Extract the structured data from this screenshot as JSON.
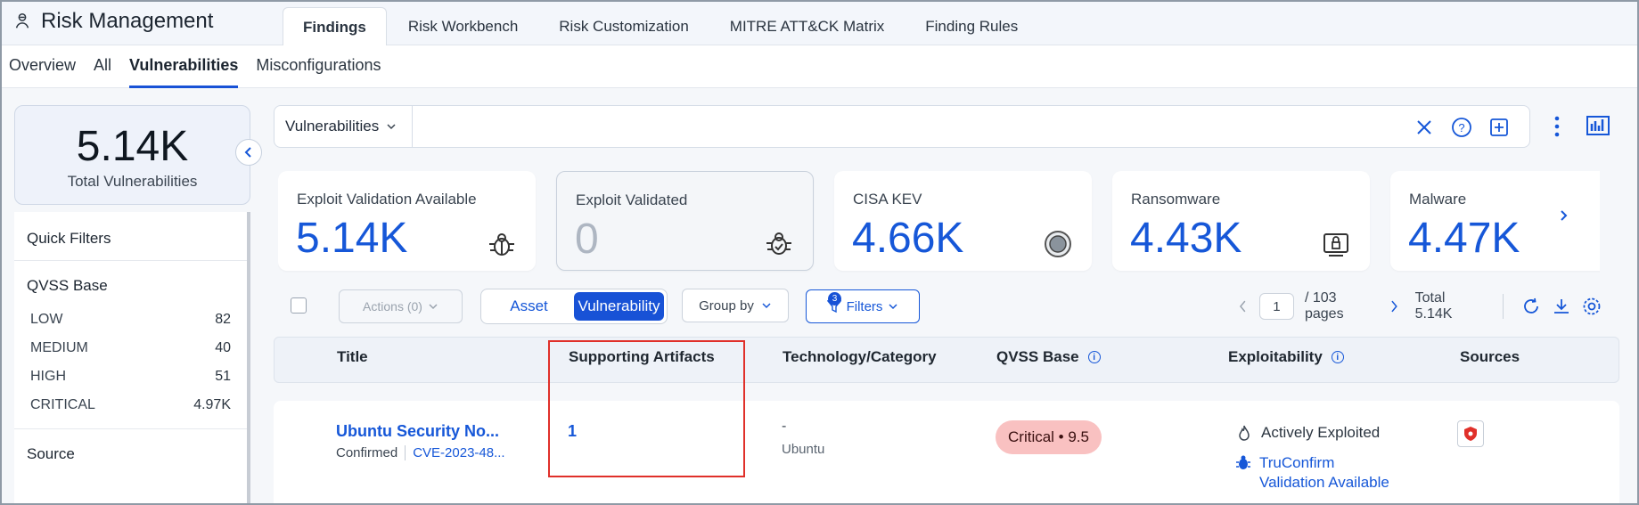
{
  "app": {
    "title": "Risk Management"
  },
  "tabs": [
    "Findings",
    "Risk Workbench",
    "Risk Customization",
    "MITRE ATT&CK Matrix",
    "Finding Rules"
  ],
  "subtabs": [
    "Overview",
    "All",
    "Vulnerabilities",
    "Misconfigurations"
  ],
  "total": {
    "value": "5.14K",
    "label": "Total Vulnerabilities"
  },
  "quick_filters": {
    "title": "Quick Filters",
    "qvss_title": "QVSS Base",
    "rows": [
      {
        "label": "LOW",
        "value": "82"
      },
      {
        "label": "MEDIUM",
        "value": "40"
      },
      {
        "label": "HIGH",
        "value": "51"
      },
      {
        "label": "CRITICAL",
        "value": "4.97K"
      }
    ],
    "source_title": "Source"
  },
  "search": {
    "select_value": "Vulnerabilities",
    "placeholder": ""
  },
  "stats": [
    {
      "label": "Exploit Validation Available",
      "value": "5.14K",
      "icon": "bug-icon"
    },
    {
      "label": "Exploit Validated",
      "value": "0",
      "icon": "bug-icon"
    },
    {
      "label": "CISA KEV",
      "value": "4.66K",
      "icon": "seal-icon"
    },
    {
      "label": "Ransomware",
      "value": "4.43K",
      "icon": "ransomware-icon"
    },
    {
      "label": "Malware",
      "value": "4.47K",
      "icon": "malware-icon"
    }
  ],
  "toolbar": {
    "actions": "Actions (0)",
    "seg": [
      "Asset",
      "Vulnerability"
    ],
    "groupby": "Group by",
    "filters": "Filters",
    "filters_count": "3",
    "page": "1",
    "pages": "/ 103 pages",
    "total": "Total 5.14K"
  },
  "table": {
    "headers": [
      "Title",
      "Supporting Artifacts",
      "Technology/Category",
      "QVSS Base",
      "Exploitability",
      "Sources"
    ],
    "row": {
      "title": "Ubuntu Security No...",
      "status": "Confirmed",
      "cve": "CVE-2023-48...",
      "artifacts": "1",
      "tech_dash": "-",
      "tech": "Ubuntu",
      "qvss": "Critical • 9.5",
      "exploit1": "Actively Exploited",
      "exploit2a": "TruConfirm",
      "exploit2b": "Validation Available"
    }
  },
  "colors": {
    "accent": "#1852d6",
    "critical": "#f9c1c1",
    "highlight": "#e0302a"
  }
}
